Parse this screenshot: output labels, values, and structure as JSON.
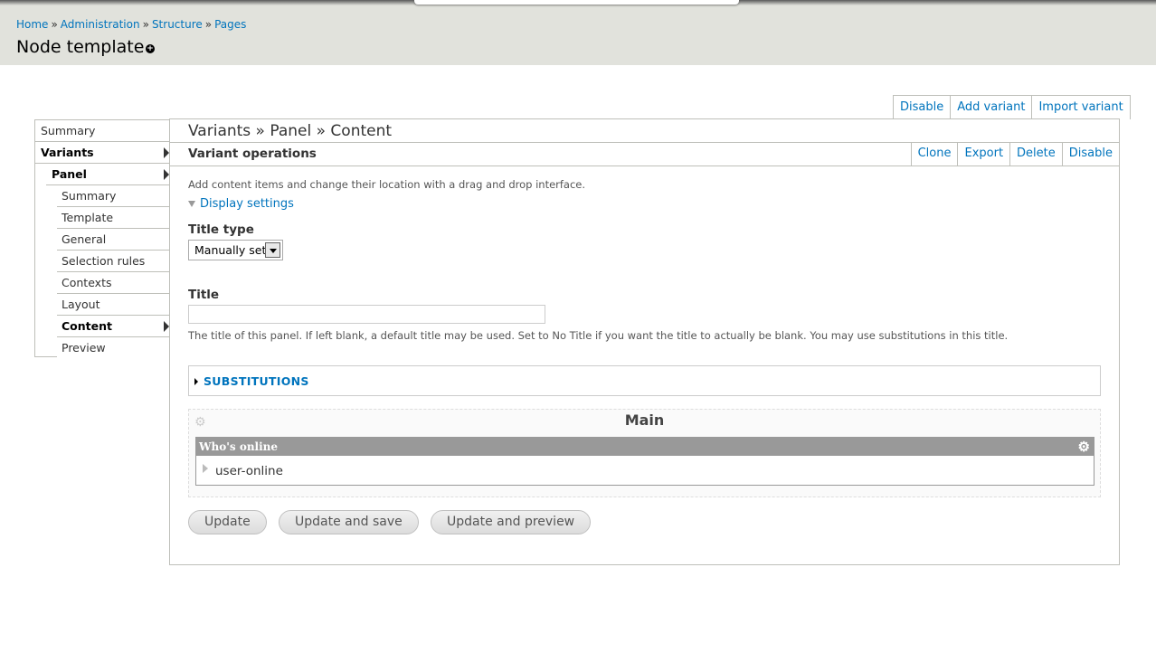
{
  "header": {
    "breadcrumb": [
      "Home",
      "Administration",
      "Structure",
      "Pages"
    ],
    "separator": "»",
    "title": "Node template",
    "shortcut_icon": "add-shortcut-icon"
  },
  "top_actions": [
    "Disable",
    "Add variant",
    "Import variant"
  ],
  "left_nav": {
    "items": [
      {
        "label": "Summary"
      },
      {
        "label": "Variants"
      },
      {
        "label": "Panel"
      },
      {
        "label": "Summary"
      },
      {
        "label": "Template"
      },
      {
        "label": "General"
      },
      {
        "label": "Selection rules"
      },
      {
        "label": "Contexts"
      },
      {
        "label": "Layout"
      },
      {
        "label": "Content"
      },
      {
        "label": "Preview"
      }
    ]
  },
  "main": {
    "heading": "Variants » Panel » Content",
    "variant_operations": {
      "label": "Variant operations",
      "links": [
        "Clone",
        "Export",
        "Delete",
        "Disable"
      ]
    },
    "description": "Add content items and change their location with a drag and drop interface.",
    "display_settings": "Display settings",
    "title_type": {
      "label": "Title type",
      "selected": "Manually set"
    },
    "title_field": {
      "label": "Title",
      "value": "",
      "help": "The title of this panel. If left blank, a default title may be used. Set to No Title if you want the title to actually be blank. You may use substitutions in this title."
    },
    "substitutions": "SUBSTITUTIONS",
    "region": {
      "title": "Main",
      "pane": {
        "title": "Who's online",
        "item": "user-online"
      }
    },
    "buttons": {
      "update": "Update",
      "update_save": "Update and save",
      "update_preview": "Update and preview"
    }
  },
  "colors": {
    "link": "#0074bd",
    "header_bg": "#e1e2dc",
    "pane_header_bg": "#999999"
  }
}
